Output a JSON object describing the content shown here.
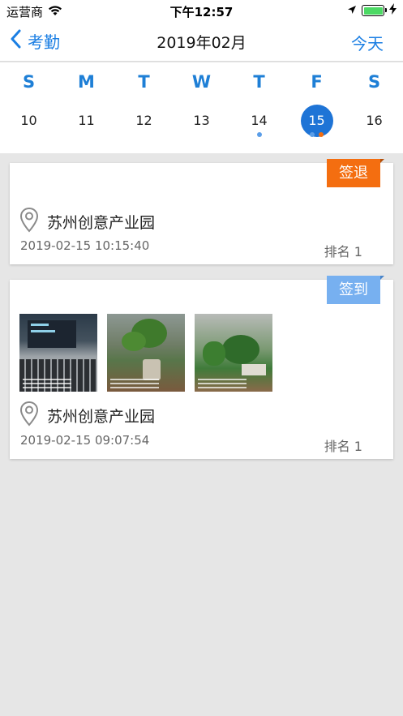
{
  "status_bar": {
    "carrier": "运营商",
    "time": "下午12:57"
  },
  "nav": {
    "back_label": "考勤",
    "title": "2019年02月",
    "right_label": "今天"
  },
  "calendar": {
    "weekdays": [
      "S",
      "M",
      "T",
      "W",
      "T",
      "F",
      "S"
    ],
    "days": [
      "10",
      "11",
      "12",
      "13",
      "14",
      "15",
      "16"
    ],
    "selected_day": "15"
  },
  "records": [
    {
      "tag": "签退",
      "tag_color": "#f46e10",
      "location": "苏州创意产业园",
      "time": "2019-02-15 10:15:40",
      "rank": "排名 1",
      "photo_count": 0
    },
    {
      "tag": "签到",
      "tag_color": "#77b0f0",
      "location": "苏州创意产业园",
      "time": "2019-02-15 09:07:54",
      "rank": "排名 1",
      "photo_count": 3
    }
  ],
  "colors": {
    "accent": "#1a7ee3",
    "checkout": "#f46e10",
    "checkin": "#77b0f0"
  }
}
